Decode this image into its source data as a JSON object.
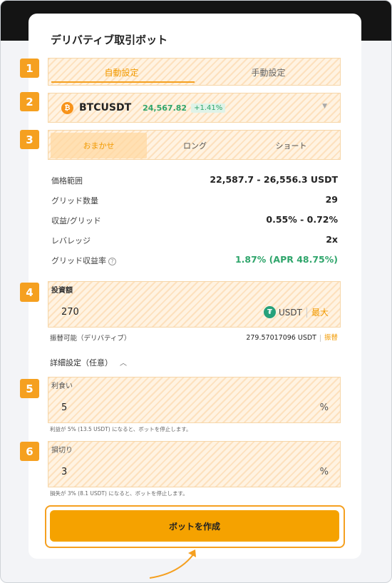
{
  "title": "デリバティブ取引ボット",
  "badges": [
    "1",
    "2",
    "3",
    "4",
    "5",
    "6"
  ],
  "mode_tabs": [
    {
      "label": "自動設定",
      "active": true
    },
    {
      "label": "手動設定",
      "active": false
    }
  ],
  "pair": {
    "icon": "bitcoin-icon",
    "name": "BTCUSDT",
    "price": "24,567.82",
    "change": "+1.41%"
  },
  "strategy_tabs": [
    {
      "label": "おまかせ",
      "active": true
    },
    {
      "label": "ロング",
      "active": false
    },
    {
      "label": "ショート",
      "active": false
    }
  ],
  "info_rows": [
    {
      "label": "価格範囲",
      "value": "22,587.7 - 26,556.3 USDT"
    },
    {
      "label": "グリッド数量",
      "value": "29"
    },
    {
      "label": "収益/グリッド",
      "value": "0.55% - 0.72%"
    },
    {
      "label": "レバレッジ",
      "value": "2x"
    },
    {
      "label": "グリッド収益率",
      "value": "1.87% (APR 48.75%)"
    }
  ],
  "investment": {
    "label": "投資額",
    "value": "270",
    "currency": "USDT",
    "max_label": "最大"
  },
  "available": {
    "label": "振替可能（デリバティブ）",
    "value": "279.57017096 USDT",
    "transfer_label": "振替"
  },
  "advanced_label": "詳細設定（任意）",
  "take_profit": {
    "label": "利食い",
    "value": "5",
    "unit": "%",
    "note": "利益が 5% (13.5 USDT) になると、ボットを停止します。"
  },
  "stop_loss": {
    "label": "損切り",
    "value": "3",
    "unit": "%",
    "note": "損失が 3% (8.1 USDT) になると、ボットを停止します。"
  },
  "create_button": "ボットを作成",
  "colors": {
    "accent": "#f5a020",
    "positive": "#2fa56b",
    "dark_band": "#141414"
  }
}
